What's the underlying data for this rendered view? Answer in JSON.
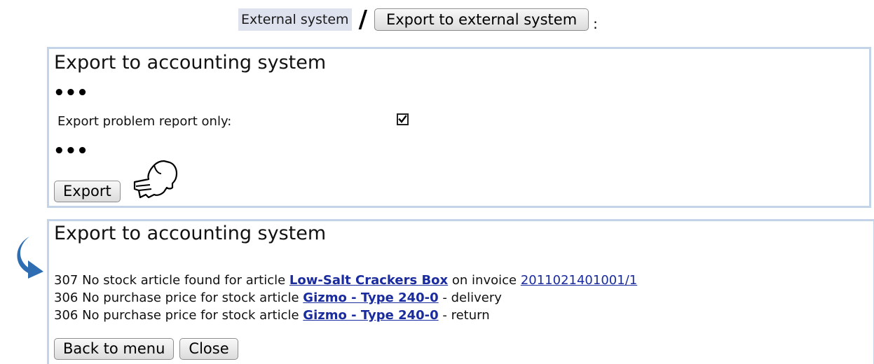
{
  "breadcrumb": {
    "menu_label": "External system",
    "separator": "/",
    "button_label": "Export to external system",
    "trailing": ":"
  },
  "export_form": {
    "title": "Export to accounting system",
    "ellipsis_top": "•••",
    "option_label": "Export problem report only:",
    "option_checked": true,
    "ellipsis_bottom": "•••",
    "export_button": "Export"
  },
  "export_result": {
    "title": "Export to accounting system",
    "lines": [
      {
        "code_text": "307 No stock article found for article ",
        "article": "Low-Salt Crackers Box",
        "middle": " on invoice ",
        "invoice": "2011021401001/1",
        "suffix": ""
      },
      {
        "code_text": "306 No purchase price for stock article ",
        "article": "Gizmo - Type 240-0",
        "middle": "",
        "invoice": "",
        "suffix": " - delivery"
      },
      {
        "code_text": "306 No purchase price for stock article ",
        "article": "Gizmo - Type 240-0",
        "middle": "",
        "invoice": "",
        "suffix": " - return"
      }
    ],
    "back_button": "Back to menu",
    "close_button": "Close"
  },
  "icons": {
    "pointer": "pointing-hand-icon",
    "arrow": "curved-arrow-icon",
    "check": "checkmark-icon"
  },
  "colors": {
    "panel_border": "#c4d4e8",
    "menu_highlight": "#dde2ee",
    "link": "#1a2b9e",
    "arrow": "#2f6db3"
  }
}
